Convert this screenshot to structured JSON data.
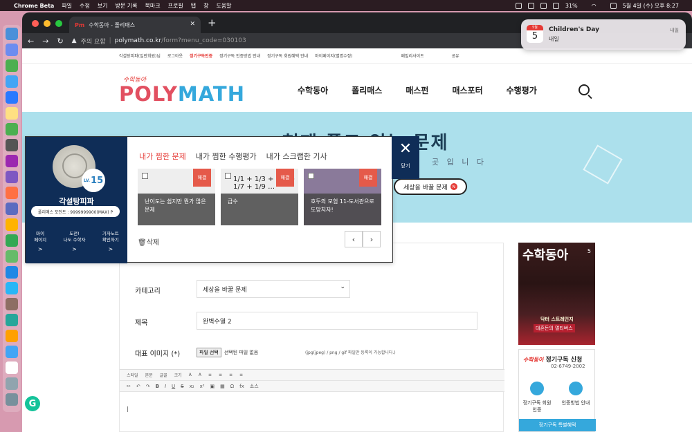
{
  "menubar": {
    "app": "Chrome Beta",
    "items": [
      "파일",
      "수정",
      "보기",
      "방문 기록",
      "북마크",
      "프로필",
      "탭",
      "창",
      "도움말"
    ],
    "battery": "31%",
    "datetime": "5월 4일 (수) 오후 8:27"
  },
  "browser": {
    "tab_title": "수학동아 - 폴리매스",
    "tab_favicon": "Pm",
    "security_warning": "주의 요함",
    "url_domain": "polymath.co.kr",
    "url_path": "/form?menu_code=030103"
  },
  "utilbar": {
    "user": "각설탕피파(일반회원)님",
    "logout": "로그아웃",
    "verify": "정기구독인증",
    "verify_guide": "정기구독 인증방법 안내",
    "benefits": "정기구독 회원혜택 안내",
    "mypage": "마이페이지(별명수정)",
    "family": "패밀리사이트",
    "share": "공유"
  },
  "site": {
    "logo_top": "수학동아",
    "logo_poly": "POLY",
    "logo_math": "MATH",
    "nav": [
      "수학동아",
      "폴리매스",
      "매스펀",
      "매스포터",
      "수행평가"
    ]
  },
  "hero": {
    "title": "현재 풀고 있는 문제",
    "subtitle": "곳 입 니 다",
    "button": "세상을 바꿀 문제",
    "badge": "N"
  },
  "form": {
    "category_label": "카테고리",
    "category_value": "세상을 바꿀 문제",
    "title_label": "제목",
    "title_value": "완벽수열 2",
    "image_label": "대표 이미지 (*)",
    "file_button": "파일 선택",
    "file_status": "선택된 파일 없음",
    "file_info": "(jpg(jpeg) / png / gif 파일만 등록이 가능합니다.)",
    "toolbar_row1": [
      "스타일",
      "본문",
      "글꼴",
      "크기"
    ],
    "toolbar_row2": [
      "B",
      "I",
      "U",
      "S",
      "x₂",
      "x²",
      "Ω",
      "fx",
      "소스"
    ]
  },
  "popup": {
    "username": "각설탕피파",
    "level_prefix": "LV.",
    "level": "15",
    "points": "폴리매스 포인트 : 9999999900(MAX) P",
    "links": [
      {
        "line1": "마이",
        "line2": "페이지"
      },
      {
        "line1": "도전!",
        "line2": "나도 수학자"
      },
      {
        "line1": "기자노트",
        "line2": "확인하기"
      }
    ],
    "arrow": ">",
    "tabs": [
      "내가 찜한 문제",
      "내가 찜한 수행평가",
      "내가 스크랩한 기사"
    ],
    "cards": [
      {
        "tag": "해결",
        "caption": "난이도는 쉽지만 뭔가 많은 문제",
        "math": ""
      },
      {
        "tag": "해결",
        "caption": "급수",
        "math": "1/1 + 1/3 + 1/5 + 1/7 + 1/9 …"
      },
      {
        "tag": "해결",
        "caption": "호두의 모험 11-도서관으로 도망치자!",
        "math": ""
      }
    ],
    "delete": "삭제",
    "prev": "‹",
    "next": "›",
    "close_label": "닫기"
  },
  "sidebar": {
    "magazine_title": "수학동아",
    "magazine_issue": "5",
    "magazine_subtitle": "닥터 스트레인지",
    "magazine_tag": "대혼돈의 멀티버스",
    "subscribe_title": "정기구독 신청",
    "subscribe_tel": "02-6749-2002",
    "verify1": "정기구독 회원인증",
    "verify2": "인증방법 안내",
    "benefit_bar": "정기구독 특별혜택"
  },
  "notification": {
    "title": "Children's Day",
    "body": "내일",
    "time": "내일",
    "calendar_day": "5",
    "calendar_month": "5월"
  },
  "grammarly": "G"
}
